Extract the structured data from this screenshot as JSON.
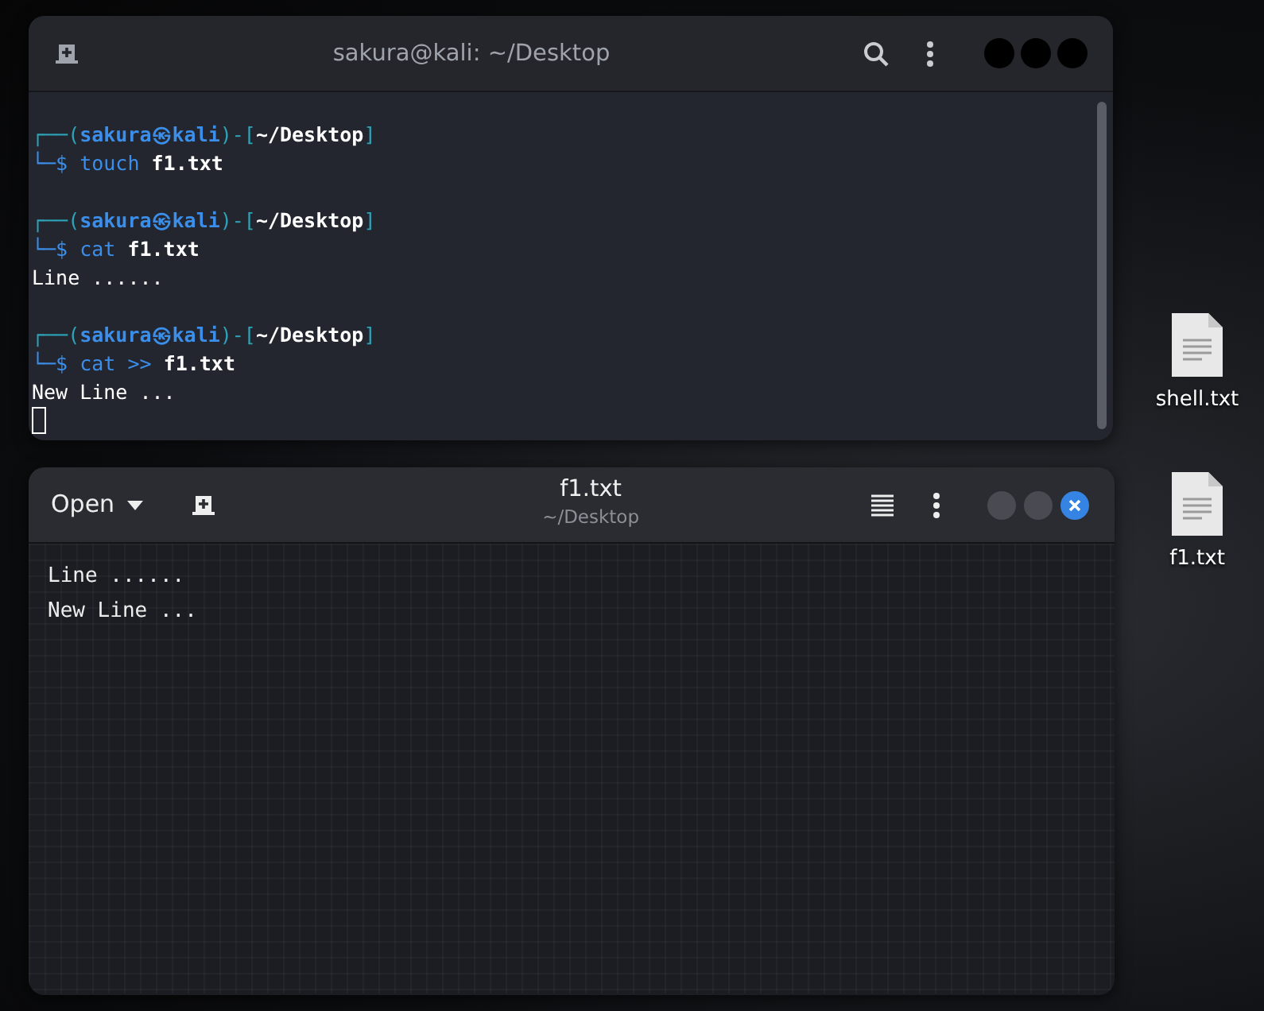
{
  "terminal": {
    "title": "sakura@kali: ~/Desktop",
    "blocks": [
      {
        "prompt": [
          {
            "text": "┌──(",
            "kind": "frame"
          },
          {
            "text": "sakura㉿kali",
            "kind": "user"
          },
          {
            "text": ")-[",
            "kind": "frame"
          },
          {
            "text": "~/Desktop",
            "kind": "path"
          },
          {
            "text": "]",
            "kind": "frame"
          }
        ],
        "command": [
          {
            "text": "└─$",
            "kind": "sign"
          },
          {
            "text": "touch",
            "kind": "command"
          },
          {
            "text": "f1.txt",
            "kind": "arg"
          }
        ]
      },
      {
        "prompt": [
          {
            "text": "┌──(",
            "kind": "frame"
          },
          {
            "text": "sakura㉿kali",
            "kind": "user"
          },
          {
            "text": ")-[",
            "kind": "frame"
          },
          {
            "text": "~/Desktop",
            "kind": "path"
          },
          {
            "text": "]",
            "kind": "frame"
          }
        ],
        "command": [
          {
            "text": "└─$",
            "kind": "sign"
          },
          {
            "text": "cat",
            "kind": "command"
          },
          {
            "text": "f1.txt",
            "kind": "arg"
          }
        ],
        "output": [
          "Line ......"
        ]
      },
      {
        "prompt": [
          {
            "text": "┌──(",
            "kind": "frame"
          },
          {
            "text": "sakura㉿kali",
            "kind": "user"
          },
          {
            "text": ")-[",
            "kind": "frame"
          },
          {
            "text": "~/Desktop",
            "kind": "path"
          },
          {
            "text": "]",
            "kind": "frame"
          }
        ],
        "command": [
          {
            "text": "└─$",
            "kind": "sign"
          },
          {
            "text": "cat",
            "kind": "command"
          },
          {
            "text": ">>",
            "kind": "command"
          },
          {
            "text": "f1.txt",
            "kind": "arg"
          }
        ],
        "output": [
          "New Line ..."
        ]
      }
    ]
  },
  "editor": {
    "open_button": "Open",
    "title": "f1.txt",
    "subtitle": "~/Desktop",
    "lines": [
      "Line ......",
      "New Line ..."
    ]
  },
  "desktop_icons": [
    {
      "label": "shell.txt"
    },
    {
      "label": "f1.txt"
    }
  ]
}
